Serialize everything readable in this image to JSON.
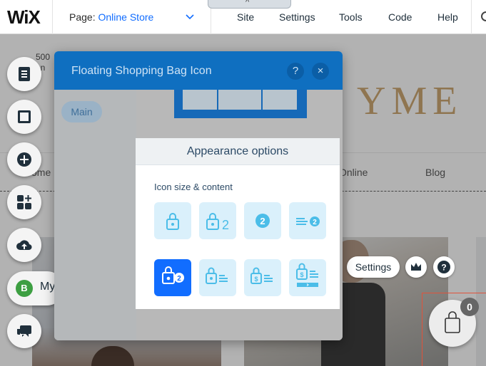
{
  "topbar": {
    "logo": "WiX",
    "page_prefix": "Page:",
    "page_value": "Online Store",
    "tab_chevron": "^",
    "menu": [
      "Site",
      "Settings",
      "Tools",
      "Code",
      "Help"
    ]
  },
  "site": {
    "address_lines": [
      "500",
      "an"
    ],
    "title": "YME",
    "nav": [
      "ome",
      "Online",
      "Blog"
    ],
    "settings_label": "Settings",
    "cart_count": "0"
  },
  "rail": {
    "my_label": "My",
    "my_badge": "B"
  },
  "panel": {
    "title": "Floating Shopping Bag Icon",
    "help": "?",
    "close": "×",
    "tab_main": "Main"
  },
  "card": {
    "heading": "Appearance options",
    "subheading": "Icon size & content",
    "options": [
      {
        "icon": "bag-icon",
        "badge": ""
      },
      {
        "icon": "bag-with-count-icon",
        "badge": "2"
      },
      {
        "icon": "count-circle-icon",
        "badge": "2"
      },
      {
        "icon": "lines-with-count-icon",
        "badge": "2"
      },
      {
        "icon": "bag-with-count-badge-icon",
        "badge": "2",
        "selected": true
      },
      {
        "icon": "bag-with-lines-icon",
        "badge": ""
      },
      {
        "icon": "dollar-bag-with-lines-icon",
        "badge": ""
      },
      {
        "icon": "dollar-bag-with-lines-and-button-icon",
        "badge": ""
      }
    ]
  },
  "colors": {
    "accent": "#116dff",
    "panel_header": "#0f6fc0",
    "option_bg": "#daf0fb",
    "option_icon": "#4bbde8"
  }
}
